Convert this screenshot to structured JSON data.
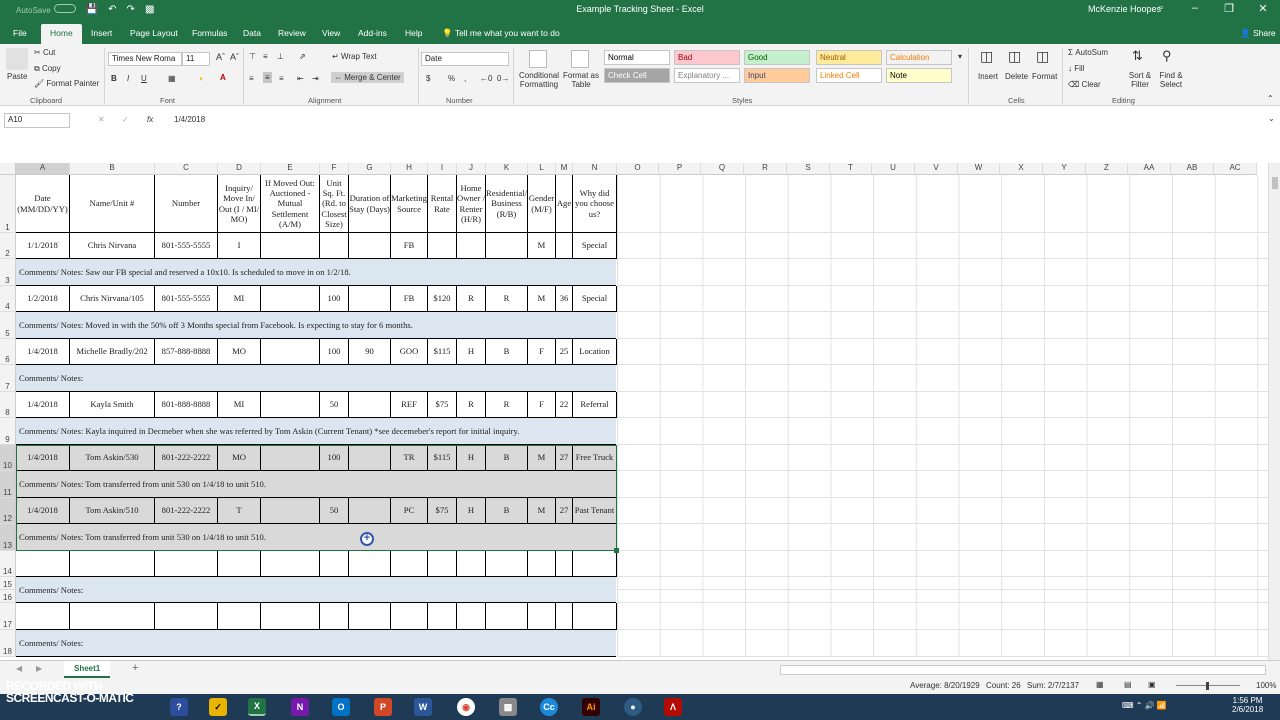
{
  "window": {
    "title": "Example Tracking Sheet - Excel",
    "user": "McKenzie Hoopes",
    "autosave": "AutoSave",
    "autosave_state": "Off"
  },
  "tabs": [
    "File",
    "Home",
    "Insert",
    "Page Layout",
    "Formulas",
    "Data",
    "Review",
    "View",
    "Add-ins",
    "Help"
  ],
  "tell_me": "Tell me what you want to do",
  "share": "Share",
  "ribbon": {
    "clipboard": {
      "paste": "Paste",
      "cut": "Cut",
      "copy": "Copy",
      "format_painter": "Format Painter",
      "label": "Clipboard"
    },
    "font": {
      "name": "Times New Roma",
      "size": "11",
      "label": "Font"
    },
    "alignment": {
      "wrap": "Wrap Text",
      "merge": "Merge & Center",
      "label": "Alignment"
    },
    "number": {
      "format": "Date",
      "label": "Number",
      "currency": "$",
      "percent": "%",
      "comma": ","
    },
    "styles": {
      "conditional": "Conditional Formatting",
      "format_table": "Format as Table",
      "label": "Styles",
      "cells": [
        {
          "t": "Normal",
          "bg": "#ffffff",
          "fg": "#000000"
        },
        {
          "t": "Bad",
          "bg": "#ffc7ce",
          "fg": "#9c0006"
        },
        {
          "t": "Good",
          "bg": "#c6efce",
          "fg": "#006100"
        },
        {
          "t": "Neutral",
          "bg": "#ffeb9c",
          "fg": "#9c5700"
        },
        {
          "t": "Calculation",
          "bg": "#f2f2f2",
          "fg": "#fa7d00"
        },
        {
          "t": "Check Cell",
          "bg": "#a5a5a5",
          "fg": "#ffffff"
        },
        {
          "t": "Explanatory ...",
          "bg": "#ffffff",
          "fg": "#7f7f7f"
        },
        {
          "t": "Input",
          "bg": "#ffcc99",
          "fg": "#3f3f76"
        },
        {
          "t": "Linked Cell",
          "bg": "#ffffff",
          "fg": "#fa7d00"
        },
        {
          "t": "Note",
          "bg": "#ffffcc",
          "fg": "#000000"
        }
      ]
    },
    "cells": {
      "insert": "Insert",
      "delete": "Delete",
      "format": "Format",
      "label": "Cells"
    },
    "editing": {
      "autosum": "AutoSum",
      "fill": "Fill",
      "clear": "Clear",
      "sort": "Sort & Filter",
      "find": "Find & Select",
      "label": "Editing"
    }
  },
  "formula_bar": {
    "name_box": "A10",
    "formula": "1/4/2018",
    "fx": "fx"
  },
  "columns": [
    "A",
    "B",
    "C",
    "D",
    "E",
    "F",
    "G",
    "H",
    "I",
    "J",
    "K",
    "L",
    "M",
    "N",
    "O",
    "P",
    "Q",
    "R",
    "S",
    "T",
    "U",
    "V",
    "W",
    "X",
    "Y",
    "Z",
    "AA",
    "AB",
    "AC"
  ],
  "headers": [
    "Date (MM/DD/YY)",
    "Name/Unit #",
    "Number",
    "Inquiry/ Move In/ Out (I / MI/ MO)",
    "If Moved Out: Auctioned - Mutual Settlement (A/M)",
    "Unit Sq. Ft. (Rd. to Closest Size)",
    "Duration of Stay (Days)",
    "Marketing Source",
    "Rental Rate",
    "Home Owner / Renter (H/R)",
    "Residential/ Business (R/B)",
    "Gender (M/F)",
    "Age",
    "Why did you choose us?"
  ],
  "records": [
    {
      "row": "2",
      "cells": [
        "1/1/2018",
        "Chris Nirvana",
        "801-555-5555",
        "I",
        "",
        "",
        "",
        "FB",
        "",
        "",
        "",
        "M",
        "",
        "Special"
      ],
      "note_row": "3",
      "note": "Comments/ Notes: Saw our FB special and reserved a 10x10. Is scheduled to move in on 1/2/18."
    },
    {
      "row": "4",
      "cells": [
        "1/2/2018",
        "Chris Nirvana/105",
        "801-555-5555",
        "MI",
        "",
        "100",
        "",
        "FB",
        "$120",
        "R",
        "R",
        "M",
        "36",
        "Special"
      ],
      "note_row": "5",
      "note": "Comments/ Notes: Moved in with the 50% off 3 Months special from Facebook. Is expecting to stay for 6 months."
    },
    {
      "row": "6",
      "cells": [
        "1/4/2018",
        "Michelle Bradly/202",
        "857-888-8888",
        "MO",
        "",
        "100",
        "90",
        "GOO",
        "$115",
        "H",
        "B",
        "F",
        "25",
        "Location"
      ],
      "note_row": "7",
      "note": "Comments/ Notes:"
    },
    {
      "row": "8",
      "cells": [
        "1/4/2018",
        "Kayla Smith",
        "801-888-8888",
        "MI",
        "",
        "50",
        "",
        "REF",
        "$75",
        "R",
        "R",
        "F",
        "22",
        "Referral"
      ],
      "note_row": "9",
      "note": "Comments/ Notes: Kayla inquired in Decmeber when she was referred by Tom Askin (Current Tenant) *see decemeber's report for initial inquiry."
    },
    {
      "row": "10",
      "cells": [
        "1/4/2018",
        "Tom Askin/530",
        "801-222-2222",
        "MO",
        "",
        "100",
        "",
        "TR",
        "$115",
        "H",
        "B",
        "M",
        "27",
        "Free Truck"
      ],
      "note_row": "11",
      "note": "Comments/ Notes: Tom transferred from unit 530 on 1/4/18 to unit 510."
    },
    {
      "row": "12",
      "cells": [
        "1/4/2018",
        "Tom Askin/510",
        "801-222-2222",
        "T",
        "",
        "50",
        "",
        "PC",
        "$75",
        "H",
        "B",
        "M",
        "27",
        "Past Tenant"
      ],
      "note_row": "13",
      "note": "Comments/ Notes: Tom transferred from unit 530 on 1/4/18 to unit 510."
    },
    {
      "row": "14",
      "cells": [
        "",
        "",
        "",
        "",
        "",
        "",
        "",
        "",
        "",
        "",
        "",
        "",
        "",
        ""
      ],
      "note_row": "15",
      "note": "Comments/ Notes:"
    },
    {
      "row": "17",
      "cells": [
        "",
        "",
        "",
        "",
        "",
        "",
        "",
        "",
        "",
        "",
        "",
        "",
        "",
        ""
      ],
      "note_row": "18",
      "note": "Comments/ Notes:"
    }
  ],
  "extra_rows": [
    "1",
    "16"
  ],
  "sheet": {
    "name": "Sheet1",
    "add": "+"
  },
  "status": {
    "average": "Average: 8/20/1929",
    "count": "Count: 26",
    "sum": "Sum: 2/7/2137",
    "zoom": "100%"
  },
  "watermark": "RECORDED WITH SCREENCAST-O-MATIC",
  "clock": {
    "time": "1:56 PM",
    "date": "2/6/2018"
  },
  "taskbar_icons": [
    "X",
    "N",
    "O",
    "P",
    "W",
    "Cc",
    "Ai"
  ]
}
